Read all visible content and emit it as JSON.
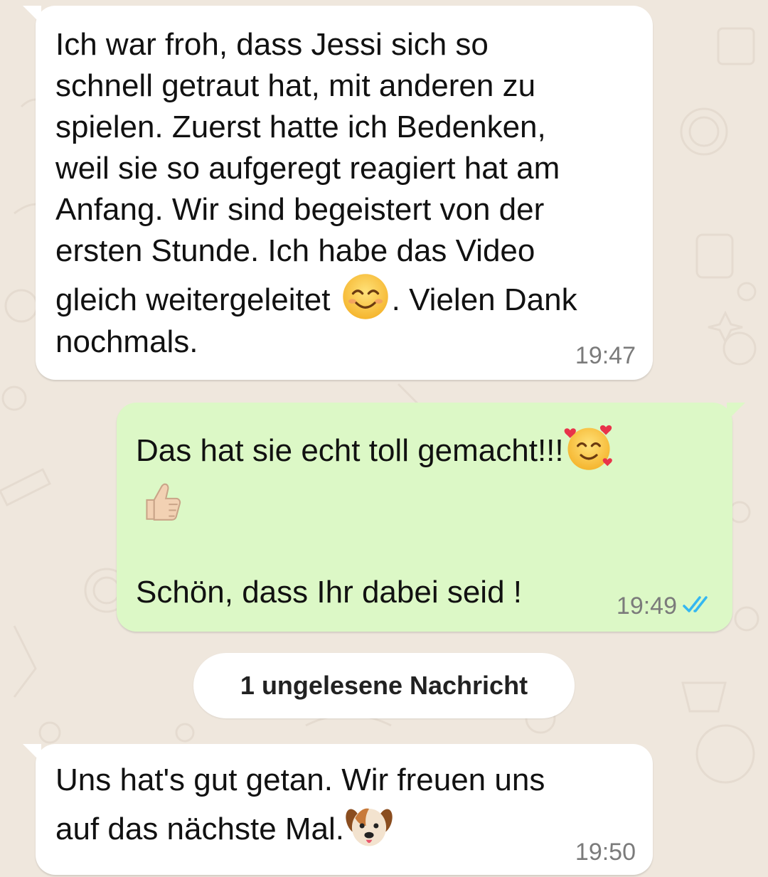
{
  "messages": [
    {
      "direction": "incoming",
      "parts": [
        "Ich war froh, dass Jessi sich so\nschnell getraut hat, mit anderen zu\nspielen. Zuerst hatte ich Bedenken,\nweil sie so aufgeregt reagiert hat am\nAnfang. Wir sind begeistert von der\nersten Stunde. Ich habe das Video\ngleich weitergeleitet ",
        ". Vielen Dank\nnochmals."
      ],
      "emoji": "smiling-face-with-smiling-eyes",
      "time": "19:47"
    },
    {
      "direction": "outgoing",
      "parts": [
        "Das hat sie echt toll gemacht!!!",
        "Schön, dass Ihr dabei seid !"
      ],
      "emojis": [
        "smiling-face-with-hearts",
        "thumbs-up-light-skin-tone"
      ],
      "time": "19:49",
      "status": "read-double-check-icon"
    },
    {
      "direction": "incoming",
      "parts": [
        "Uns hat's gut getan. Wir freuen uns\nauf das nächste Mal."
      ],
      "emoji": "dog-face",
      "time": "19:50"
    }
  ],
  "unread_divider": "1 ungelesene Nachricht",
  "colors": {
    "background": "#efe7dd",
    "incoming_bubble": "#ffffff",
    "outgoing_bubble": "#dcf8c6",
    "read_ticks": "#34b7f1",
    "timestamp": "#7b7b7b"
  }
}
